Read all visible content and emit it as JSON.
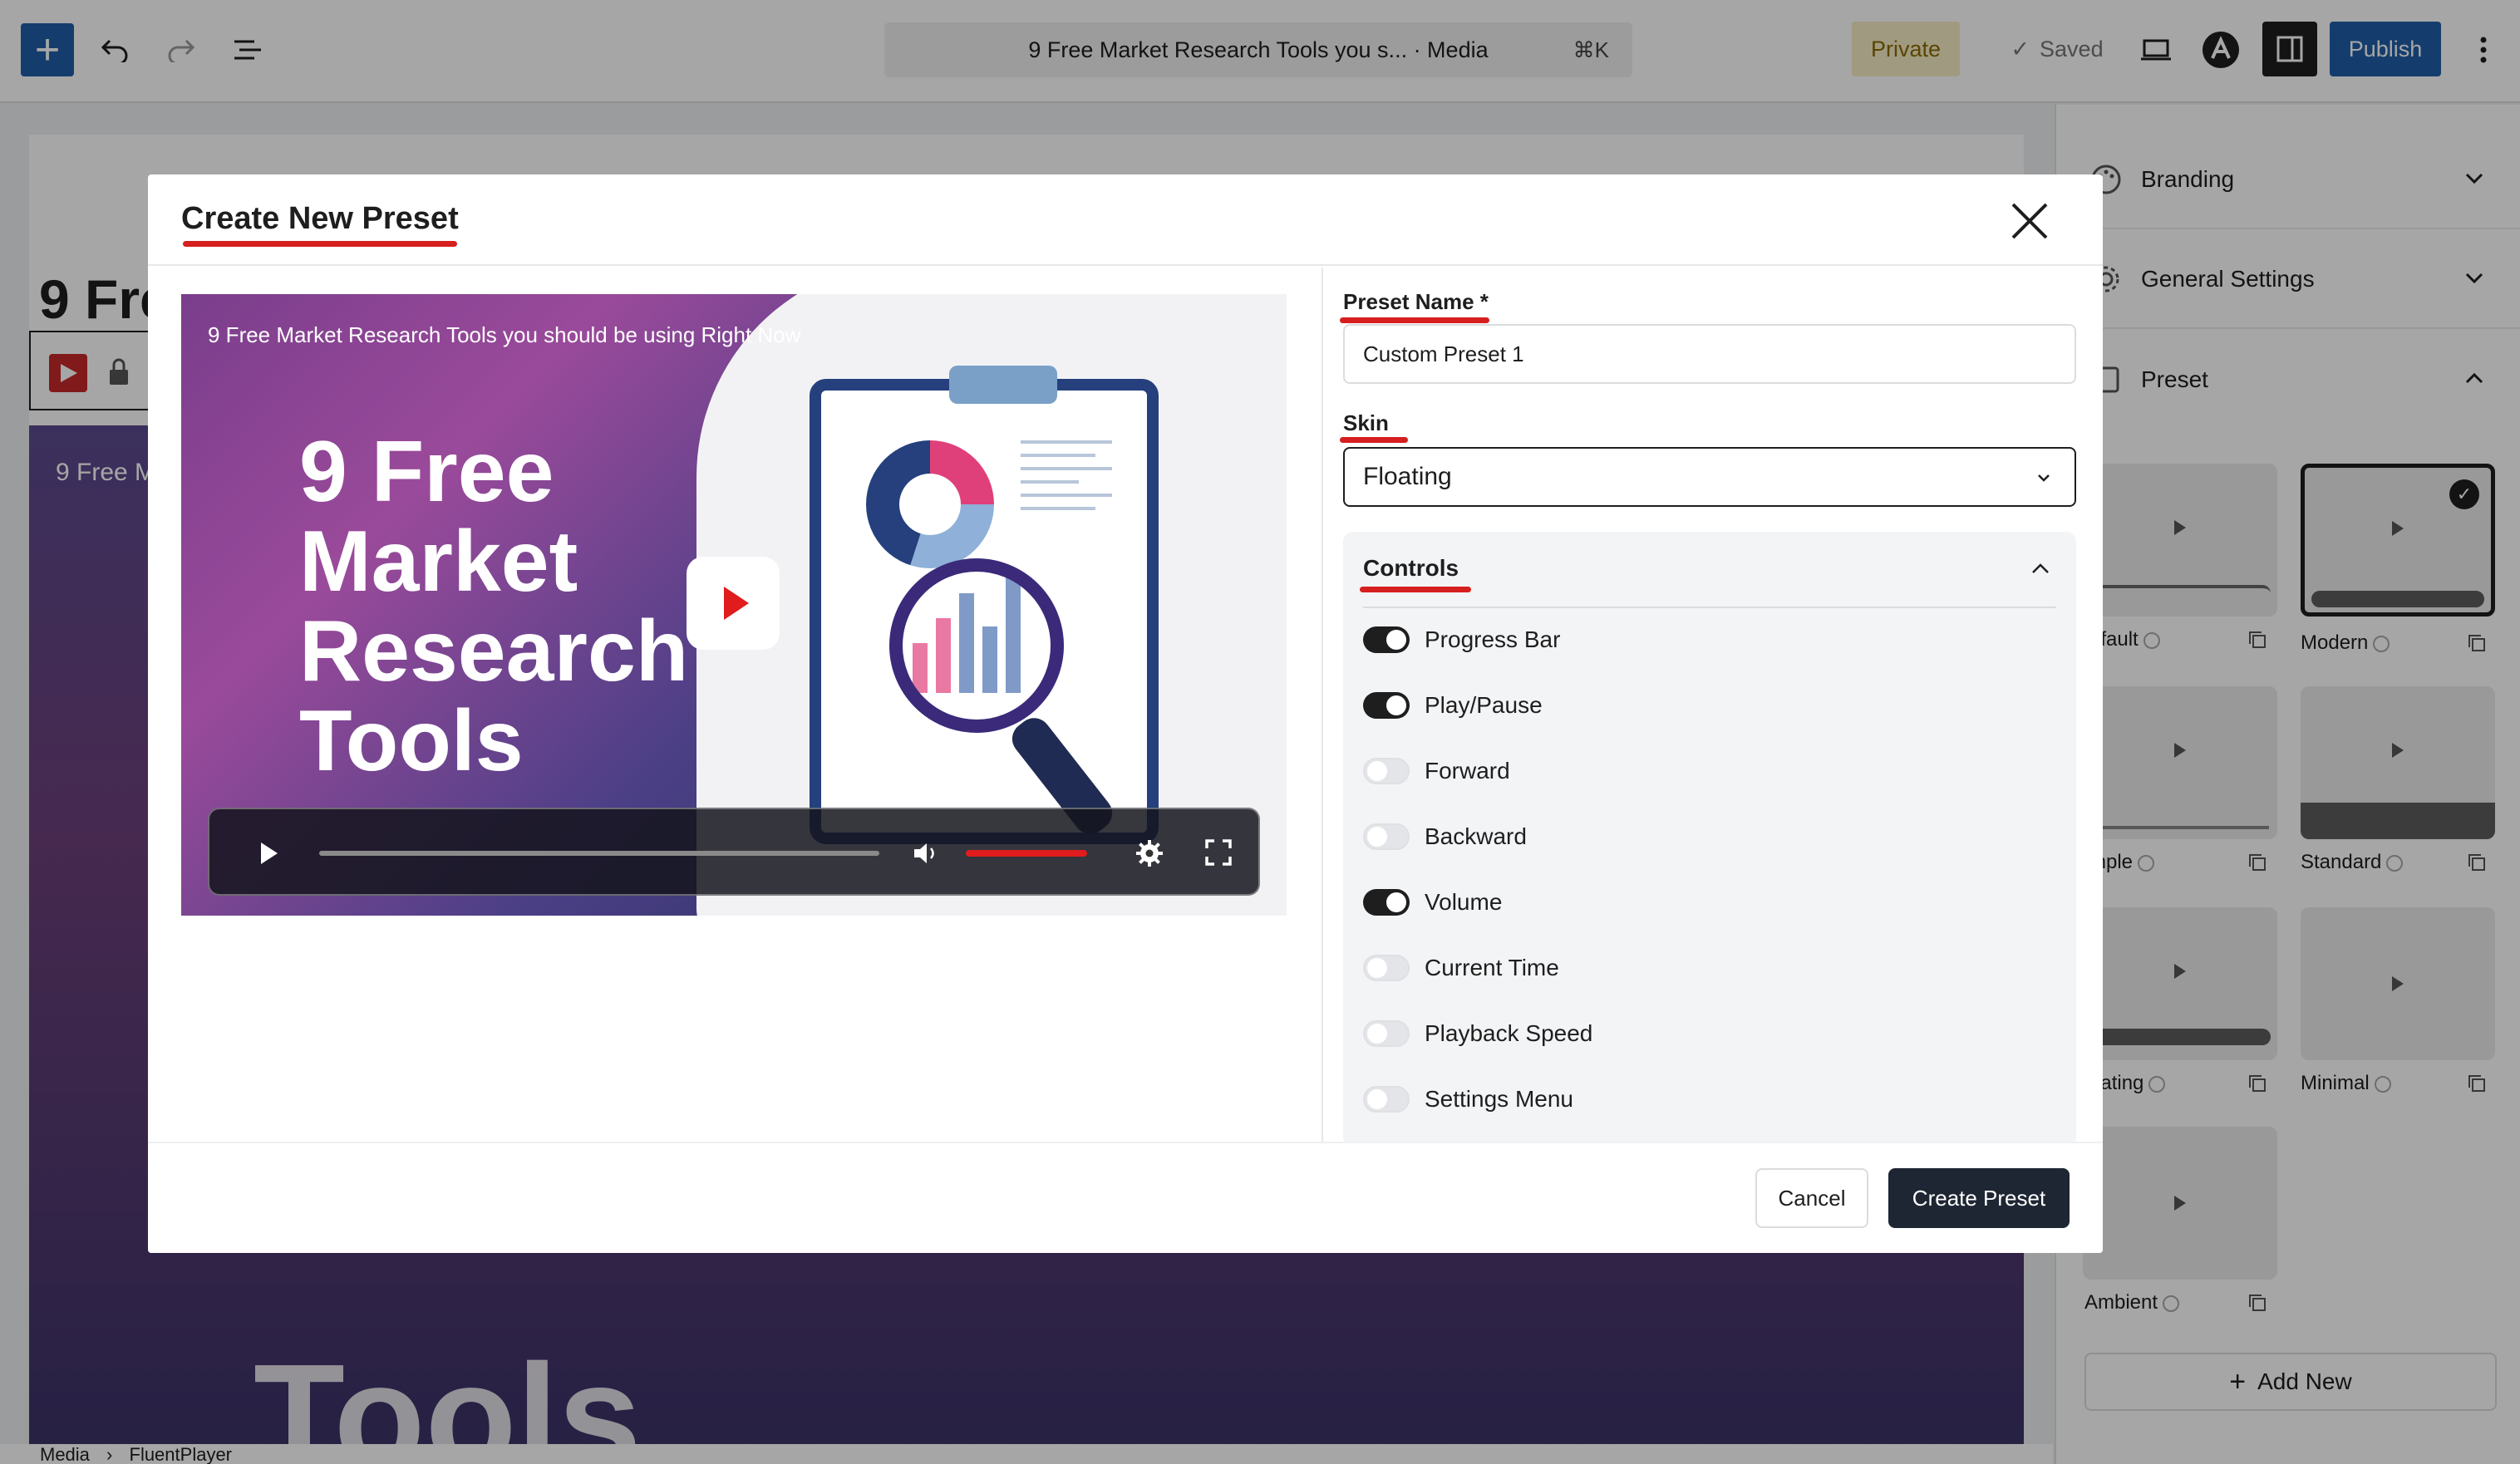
{
  "topbar": {
    "command_text": "9 Free Market Research Tools you s... · Media",
    "command_shortcut": "⌘K",
    "private_label": "Private",
    "saved_label": "Saved",
    "publish_label": "Publish"
  },
  "editor": {
    "title_fragment": "9 Fre",
    "video_caption_fragment": "9 Free M",
    "video_big_text_fragment": "Tools",
    "breadcrumb": [
      "Media",
      "FluentPlayer"
    ]
  },
  "sidebar": {
    "sections": [
      {
        "label": "Branding",
        "icon": "palette-icon",
        "expanded": false
      },
      {
        "label": "General Settings",
        "icon": "gear-icon",
        "expanded": false
      },
      {
        "label": "Preset",
        "icon": "preset-icon",
        "expanded": true
      }
    ],
    "presets": [
      {
        "label": "efault",
        "selected": false
      },
      {
        "label": "Modern",
        "selected": true
      },
      {
        "label": "mple",
        "selected": false
      },
      {
        "label": "Standard",
        "selected": false
      },
      {
        "label": "oating",
        "selected": false
      },
      {
        "label": "Minimal",
        "selected": false
      },
      {
        "label": "Ambient",
        "selected": false
      }
    ],
    "add_new_label": "Add New"
  },
  "modal": {
    "title": "Create New Preset",
    "preview": {
      "caption": "9 Free Market Research Tools you should be using Right Now",
      "big_text": "9 Free Market Research Tools",
      "progress": 0,
      "volume": 1
    },
    "form": {
      "preset_name_label": "Preset Name *",
      "preset_name_value": "Custom Preset 1",
      "skin_label": "Skin",
      "skin_value": "Floating",
      "controls_title": "Controls",
      "controls": [
        {
          "label": "Progress Bar",
          "on": true
        },
        {
          "label": "Play/Pause",
          "on": true
        },
        {
          "label": "Forward",
          "on": false
        },
        {
          "label": "Backward",
          "on": false
        },
        {
          "label": "Volume",
          "on": true
        },
        {
          "label": "Current Time",
          "on": false
        },
        {
          "label": "Playback Speed",
          "on": false
        },
        {
          "label": "Settings Menu",
          "on": false
        }
      ]
    },
    "footer": {
      "cancel_label": "Cancel",
      "create_label": "Create Preset"
    }
  },
  "colors": {
    "accent": "#1f5fa8",
    "highlight_underline": "#d61f1f",
    "dark_button": "#1e2633",
    "private_bg": "#f6edc6"
  }
}
